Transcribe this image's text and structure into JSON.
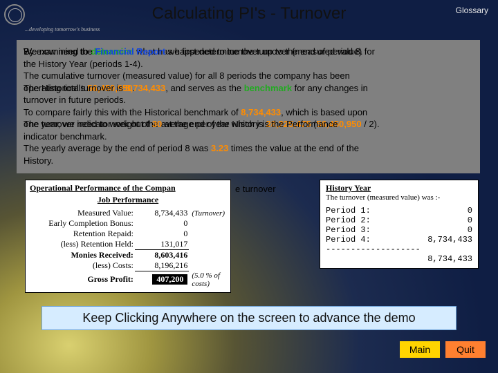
{
  "header": {
    "title": "Calculating PI's - Turnover",
    "glossary": "Glossary",
    "tagline": "...developing tomorrow's business"
  },
  "grey_back": {
    "l1a": "We now need to ",
    "l1b": "determine",
    "l1c": " what has happened to turnover up to the end of period 8.",
    "l3a": "The cumulative turnover (measured value) for all 8 periods the company has been",
    "l4a": "operating totals ",
    "l4b": "56,450,950",
    "l4c": ".",
    "l6a": "To compare fairly this with the Historical benchmark of ",
    "l6b": "8,734,433",
    "l6c": ", which is based upon",
    "l7a": "one year, we need to work out the average per year which is ",
    "l7b": "28,225,475",
    "l7c": " (",
    "l7d": "56,450,950",
    "l7e": " / 2).",
    "l9a": "The yearly average by the end of period 8 was ",
    "l9b": "3.23",
    "l9c": " times the value at the end of the",
    "l10a": "History."
  },
  "grey_front": {
    "l1a": "By examining the ",
    "l1b": "Financial Report",
    "l1c": " we first determine the turnover (measured value) for",
    "l2a": "the History Year (periods 1-4).",
    "l4a": "The Historical turnover is ",
    "l4b": "8,734,433",
    "l4c": ", and serves as the ",
    "l4d": "benchmark",
    "l4e": " for any changes in",
    "l5a": "turnover in future periods.",
    "l7a": "The turnover indicator weight of ",
    "l7b": "30",
    "l7c": " at the end of the History is the Performance",
    "l8a": "indicator benchmark."
  },
  "mid_sentence": "e turnover",
  "op_perf": {
    "heading": "Operational Performance of the Compan",
    "sub": "Job Performance",
    "rows": [
      {
        "label": "Measured Value:",
        "val": "8,734,433",
        "note": "(Turnover)"
      },
      {
        "label": "Early Completion Bonus:",
        "val": "0"
      },
      {
        "label": "Retention Repaid:",
        "val": "0"
      },
      {
        "label": "(less) Retention Held:",
        "val": "131,017"
      }
    ],
    "monies_label": "Monies Received:",
    "monies_val": "8,603,416",
    "costs_label": "(less) Costs:",
    "costs_val": "8,196,216",
    "gp_label": "Gross Profit:",
    "gp_val": "407,200",
    "gp_note": "(5.0 % of costs)"
  },
  "history": {
    "head": "History Year",
    "sub": "The turnover (measured value) was :-",
    "rows": [
      {
        "label": "Period  1:",
        "val": "0"
      },
      {
        "label": "Period  2:",
        "val": "0"
      },
      {
        "label": "Period  3:",
        "val": "0"
      },
      {
        "label": "Period  4:",
        "val": "8,734,433"
      }
    ],
    "dash": "-------------------",
    "total": "8,734,433"
  },
  "footer": {
    "advance": "Keep Clicking Anywhere on the screen to advance the demo",
    "main": "Main",
    "quit": "Quit"
  }
}
